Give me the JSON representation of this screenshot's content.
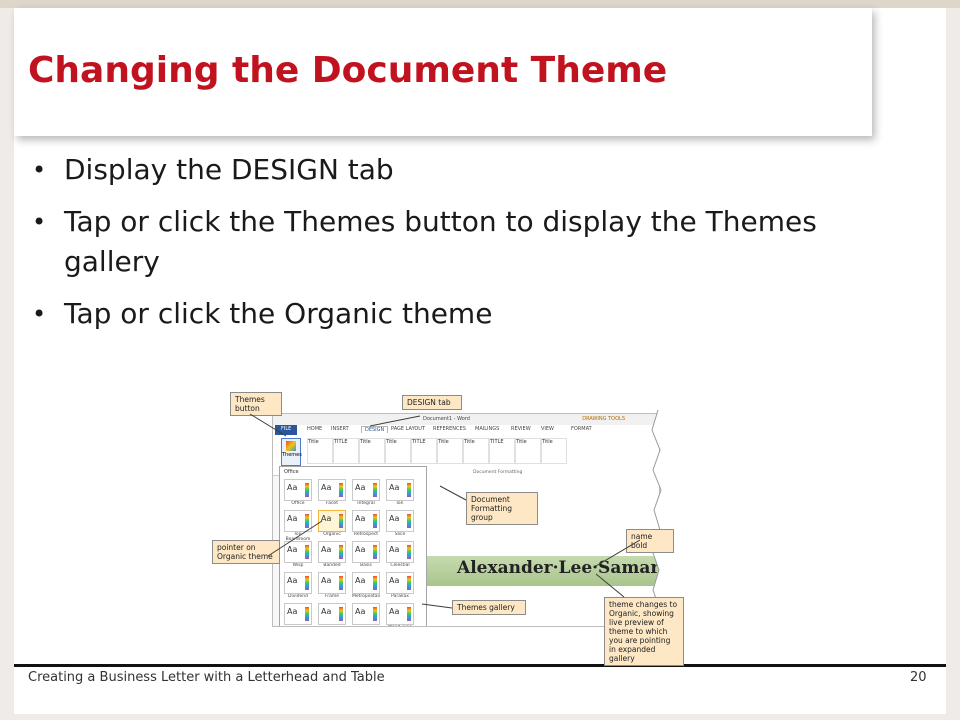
{
  "slide": {
    "title": "Changing the Document Theme",
    "bullets": [
      "Display the DESIGN tab",
      "Tap or click the Themes button to display the Themes gallery",
      "Tap or click the Organic theme"
    ],
    "footer_text": "Creating a Business Letter with a Letterhead and Table",
    "page_number": "20"
  },
  "screenshot": {
    "window_title": "Document1 - Word",
    "contextual_tab": "DRAWING TOOLS",
    "tabs": [
      "FILE",
      "HOME",
      "INSERT",
      "DESIGN",
      "PAGE LAYOUT",
      "REFERENCES",
      "MAILINGS",
      "REVIEW",
      "VIEW",
      "FORMAT"
    ],
    "themes_button_label": "Themes",
    "document_formatting_label": "Document Formatting",
    "style_thumb_labels": [
      "Title",
      "TITLE",
      "Title",
      "Title",
      "TITLE",
      "Title",
      "Title",
      "TITLE",
      "Title",
      "Title"
    ],
    "gallery_group_label": "Office",
    "themes": [
      "Office",
      "Facet",
      "Integral",
      "Ion",
      "Ion Boardroom",
      "Organic",
      "Retrospect",
      "Slice",
      "Wisp",
      "Banded",
      "Basis",
      "Celestial",
      "Dividend",
      "Frame",
      "Metropolitan",
      "Parallax",
      "",
      "",
      "",
      "Wood Type"
    ],
    "selected_theme": "Organic",
    "sample_name": "Alexander·Lee·Samara",
    "theme_thumb_text": "Aa"
  },
  "callouts": {
    "themes_button": "Themes button",
    "design_tab": "DESIGN tab",
    "document_formatting_group": "Document Formatting group",
    "name_bold": "name bold",
    "pointer_on_organic": "pointer on Organic theme",
    "themes_gallery": "Themes gallery",
    "live_preview": "theme changes to Organic, showing live preview of theme to which you are pointing in expanded gallery"
  },
  "colors": {
    "title": "#c1121f",
    "callout_fill": "#fde7c4",
    "word_blue": "#2b579a",
    "name_band": "#b8cf9f"
  }
}
